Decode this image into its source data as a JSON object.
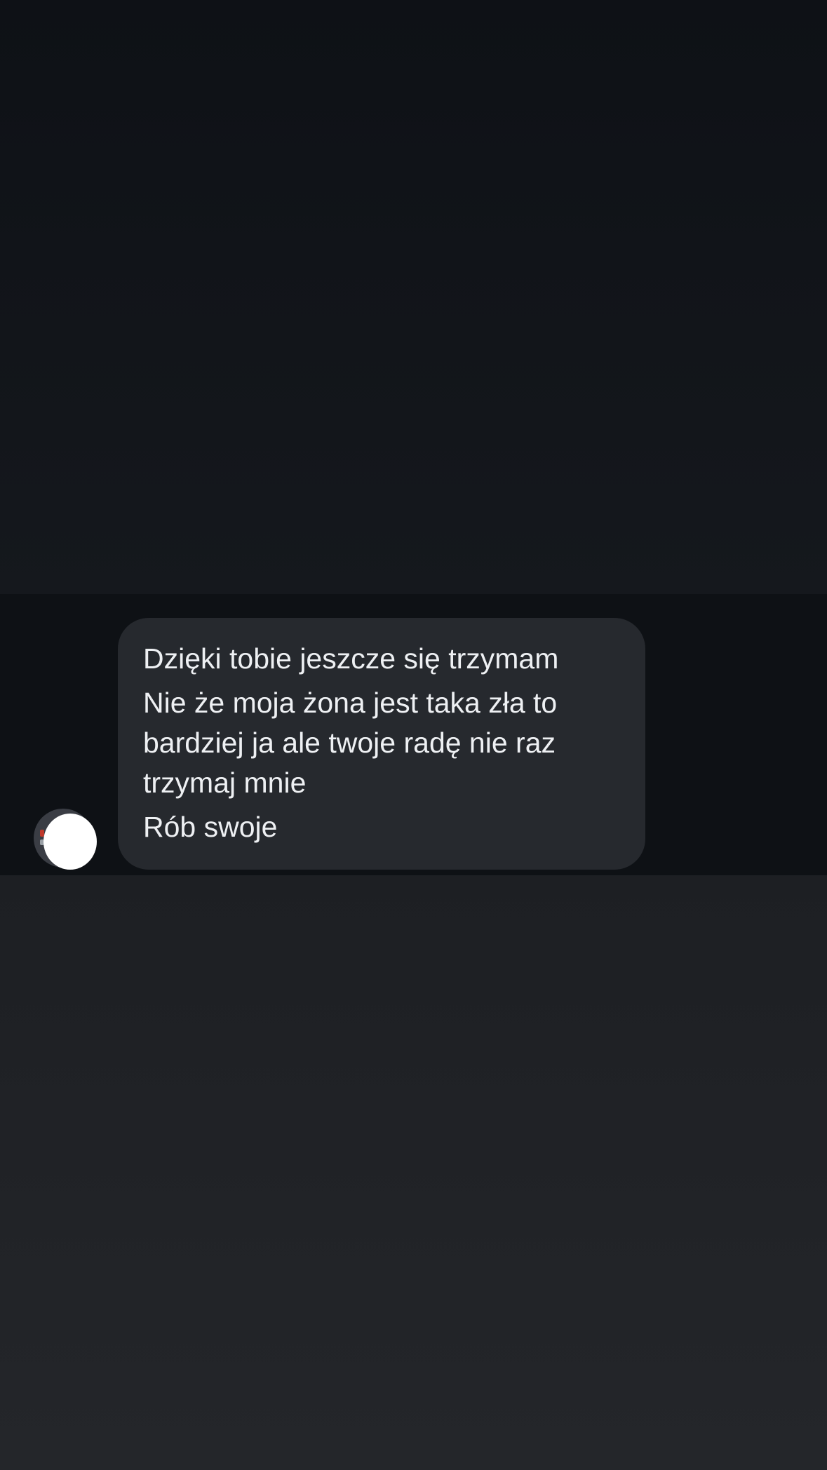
{
  "conversation": {
    "message": {
      "lines": [
        "Dzięki tobie jeszcze się trzymam",
        "Nie że moja żona jest taka zła to bardziej ja ale twoje radę nie raz trzymaj mnie",
        "Rób swoje"
      ]
    },
    "sender_avatar": {
      "icon": "profile-picture"
    }
  },
  "colors": {
    "background_top": "#0e1116",
    "background_bottom": "#24262a",
    "chat_strip": "#0e1115",
    "bubble": "#26292e",
    "text": "#eef0f3"
  }
}
